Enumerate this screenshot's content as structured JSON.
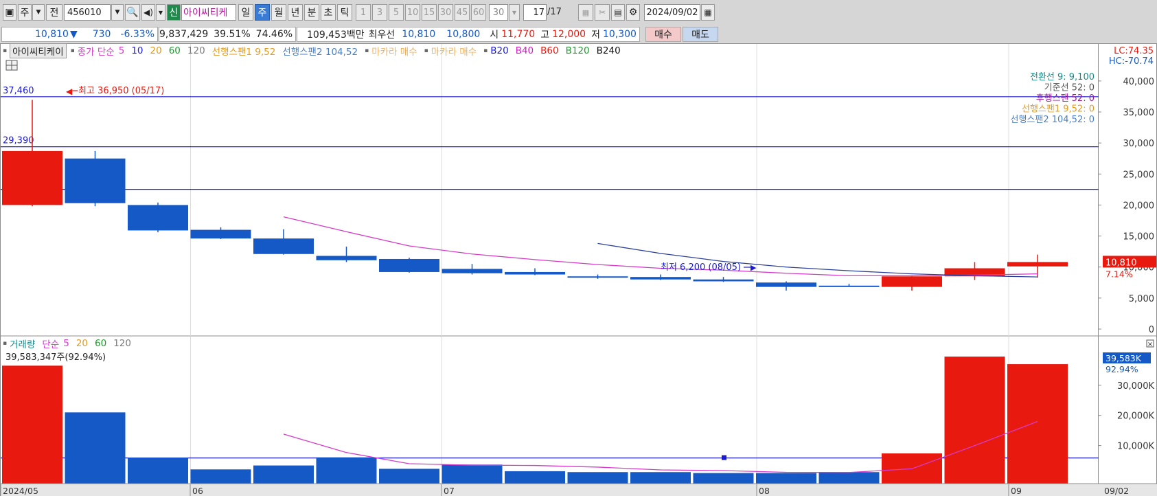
{
  "toolbar": {
    "period": "주",
    "prev": "전",
    "code": "456010",
    "new_badge": "신",
    "name": "아이씨티케",
    "periods": [
      "일",
      "주",
      "월",
      "년",
      "분",
      "초",
      "틱"
    ],
    "selected_period": "주",
    "intervals": [
      "1",
      "3",
      "5",
      "10",
      "15",
      "30",
      "45",
      "60"
    ],
    "interval_value": "30",
    "page": "17",
    "page_total": "/17",
    "date": "2024/09/02"
  },
  "quote": {
    "price": "10,810",
    "direction": "▼",
    "change": "730",
    "change_pct": "-6.33%",
    "volume": "9,837,429",
    "ratio1": "39.51%",
    "ratio2": "74.46%",
    "amount": "109,453백만",
    "best_label": "최우선",
    "best_ask": "10,810",
    "best_bid": "10,800",
    "open_label": "시",
    "open": "11,770",
    "high_label": "고",
    "high": "12,000",
    "low_label": "저",
    "low": "10,300",
    "buy": "매수",
    "sell": "매도"
  },
  "legend": {
    "stock_name": "아이씨티케이",
    "ma_label": "종가 단순",
    "ma_periods": [
      "5",
      "10",
      "20",
      "60",
      "120"
    ],
    "span1": "선행스팬1 9,52",
    "span2": "선행스팬2 104,52",
    "makara1": "마카라 매수",
    "makara2": "마카라 매수",
    "bands": [
      "B20",
      "B40",
      "B60",
      "B120",
      "B240"
    ]
  },
  "volume_legend": {
    "label": "거래량",
    "ma_label": "단순",
    "periods": [
      "5",
      "20",
      "60",
      "120"
    ],
    "current": "39,583,347주(92.94%)"
  },
  "ichimoku": {
    "conv": "전환선 9: 9,100",
    "base": "기준선 52: 0",
    "lag": "후행스팬 52: 0",
    "span1": "선행스팬1 9,52: 0",
    "span2": "선행스팬2 104,52: 0"
  },
  "annotations": {
    "high": "최고 36,950 (05/17)",
    "low": "최저 6,200 (08/05)",
    "line1": "37,460",
    "line2": "29,390",
    "line3": "22,529",
    "vol_line": "5,886K"
  },
  "axis": {
    "lc": "LC:74.35",
    "hc": "HC:-70.74",
    "price_ticks": [
      "40,000",
      "35,000",
      "30,000",
      "25,000",
      "20,000",
      "15,000",
      "10,000",
      "5,000",
      "0"
    ],
    "current_price": "10,810",
    "current_pct": "7.14%",
    "vol_ticks": [
      "30,000K",
      "20,000K",
      "10,000K"
    ],
    "current_vol": "39,583K",
    "current_vol_pct": "92.94%"
  },
  "x_labels": [
    "2024/05",
    "06",
    "07",
    "08",
    "09",
    "09/02"
  ],
  "colors": {
    "up": "#e8190f",
    "down": "#1559c7",
    "ma": "#d63bc9",
    "span2": "#2a3f9a",
    "line": "#1a1ad6"
  },
  "chart_data": {
    "type": "candlestick",
    "candles": [
      {
        "o": 20000,
        "h": 36950,
        "l": 19800,
        "c": 28700
      },
      {
        "o": 27500,
        "h": 28700,
        "l": 19800,
        "c": 20300
      },
      {
        "o": 20000,
        "h": 20400,
        "l": 15600,
        "c": 15900
      },
      {
        "o": 16000,
        "h": 16400,
        "l": 14500,
        "c": 14600
      },
      {
        "o": 14600,
        "h": 16100,
        "l": 12000,
        "c": 12100
      },
      {
        "o": 11800,
        "h": 13300,
        "l": 10800,
        "c": 11100
      },
      {
        "o": 11300,
        "h": 11500,
        "l": 9100,
        "c": 9200
      },
      {
        "o": 9700,
        "h": 10500,
        "l": 8800,
        "c": 9000
      },
      {
        "o": 9200,
        "h": 9800,
        "l": 8700,
        "c": 8800
      },
      {
        "o": 8500,
        "h": 8800,
        "l": 8100,
        "c": 8300
      },
      {
        "o": 8400,
        "h": 8800,
        "l": 7900,
        "c": 8000
      },
      {
        "o": 8000,
        "h": 8400,
        "l": 7600,
        "c": 7700
      },
      {
        "o": 7500,
        "h": 7700,
        "l": 6200,
        "c": 6800
      },
      {
        "o": 7000,
        "h": 7300,
        "l": 6800,
        "c": 6900
      },
      {
        "o": 6800,
        "h": 8600,
        "l": 6200,
        "c": 8500
      },
      {
        "o": 8500,
        "h": 10800,
        "l": 7900,
        "c": 9800
      },
      {
        "o": 10100,
        "h": 12000,
        "l": 8300,
        "c": 10810
      }
    ],
    "volume": [
      36500,
      21000,
      6000,
      2100,
      3400,
      6100,
      2300,
      3700,
      1500,
      1200,
      1200,
      900,
      900,
      1200,
      7400,
      39500,
      37000
    ],
    "ma5_price": [
      null,
      null,
      null,
      null,
      18100,
      15700,
      13400,
      12100,
      11200,
      10400,
      9800,
      9500,
      9000,
      8600,
      8600,
      8700,
      8900
    ],
    "span2_price": [
      null,
      null,
      null,
      null,
      null,
      null,
      null,
      null,
      null,
      13800,
      12200,
      10900,
      10000,
      9400,
      8900,
      8600,
      8400
    ],
    "ma5_volume": [
      null,
      null,
      null,
      null,
      13800,
      7700,
      3980,
      3520,
      3400,
      2860,
      1940,
      1700,
      1140,
      1080,
      2320,
      10000,
      18000
    ]
  }
}
